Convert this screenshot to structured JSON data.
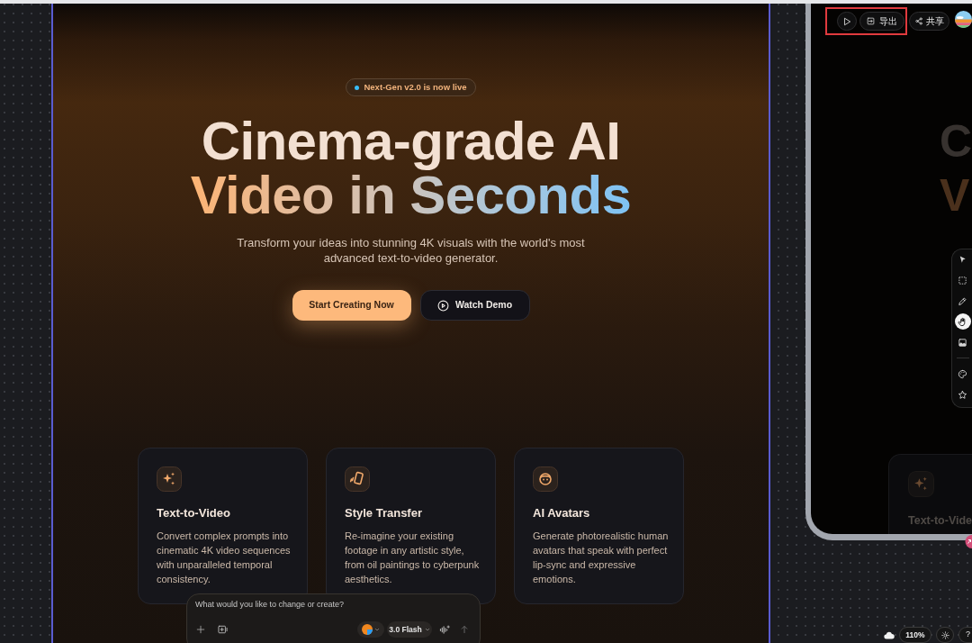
{
  "hero": {
    "badge": "Next-Gen v2.0 is now live",
    "headline": [
      {
        "text": "Cinema-grade AI",
        "kind": "plain"
      },
      {
        "text": "Video in Seconds",
        "kind": "gradient"
      }
    ],
    "subtitle": "Transform your ideas into stunning 4K visuals with the world's most advanced text-to-video generator.",
    "buttons": [
      {
        "label": "Start Creating Now",
        "kind": "primary"
      },
      {
        "label": "Watch Demo",
        "kind": "secondary"
      }
    ]
  },
  "features": [
    {
      "title": "Text-to-Video",
      "description": "Convert complex prompts into cinematic 4K video sequences with unparalleled temporal consistency."
    },
    {
      "title": "Style Transfer",
      "description": "Re-imagine your existing footage in any artistic style, from oil paintings to cyberpunk aesthetics."
    },
    {
      "title": "AI Avatars",
      "description": "Generate photorealistic human avatars that speak with perfect lip-sync and expressive emotions."
    }
  ],
  "phone_preview": {
    "headline_letters": [
      "C",
      "V"
    ],
    "feature_title": "Text-to-Vide"
  },
  "top_bar": {
    "export_label": "导出",
    "share_label": "共享"
  },
  "tool_groups": [
    {
      "tools": [
        {
          "selected": false
        },
        {
          "selected": false
        },
        {
          "selected": false
        },
        {
          "selected": true
        },
        {
          "selected": false
        }
      ]
    },
    {
      "tools": [
        {
          "selected": false
        },
        {
          "selected": false
        }
      ]
    }
  ],
  "prompt_bar": {
    "placeholder": "What would you like to change or create?",
    "model": "3.0 Flash"
  },
  "status": {
    "zoom": "110%",
    "help": "?"
  }
}
